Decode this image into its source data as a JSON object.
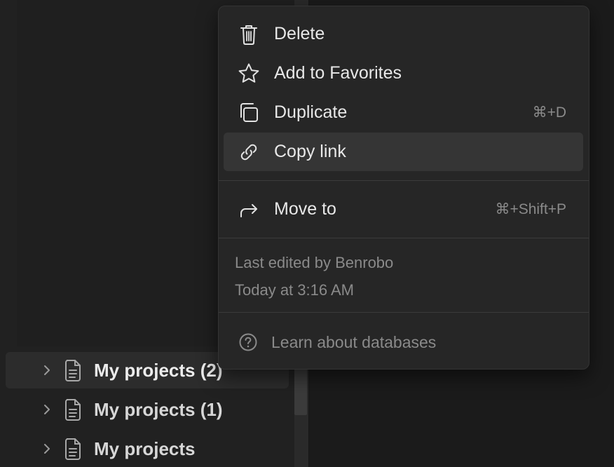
{
  "sidebar": {
    "items": [
      {
        "label": "My projects (2)",
        "icon": "doc-icon",
        "expand_icon": "chevron-right-icon",
        "active": true
      },
      {
        "label": "My projects (1)",
        "icon": "doc-icon",
        "expand_icon": "chevron-right-icon",
        "active": false
      },
      {
        "label": "My projects",
        "icon": "doc-icon",
        "expand_icon": "chevron-right-icon",
        "active": false
      }
    ]
  },
  "context_menu": {
    "items": [
      {
        "label": "Delete",
        "icon": "trash-icon",
        "shortcut": ""
      },
      {
        "label": "Add to Favorites",
        "icon": "star-icon",
        "shortcut": ""
      },
      {
        "label": "Duplicate",
        "icon": "duplicate-icon",
        "shortcut": "⌘+D"
      },
      {
        "label": "Copy link",
        "icon": "link-icon",
        "shortcut": "",
        "highlighted": true
      },
      {
        "label": "Move to",
        "icon": "move-arrow-icon",
        "shortcut": "⌘+Shift+P"
      }
    ],
    "meta": {
      "edited_by": "Last edited by Benrobo",
      "edited_at": "Today at 3:16 AM"
    },
    "help": {
      "label": "Learn about databases",
      "icon": "help-circle-icon"
    }
  },
  "colors": {
    "background": "#1e1e1e",
    "sidebar": "#212121",
    "menu_background": "#262626",
    "menu_hover": "#353535",
    "text_primary": "#e8e8e8",
    "text_muted": "#8a8a8a"
  }
}
